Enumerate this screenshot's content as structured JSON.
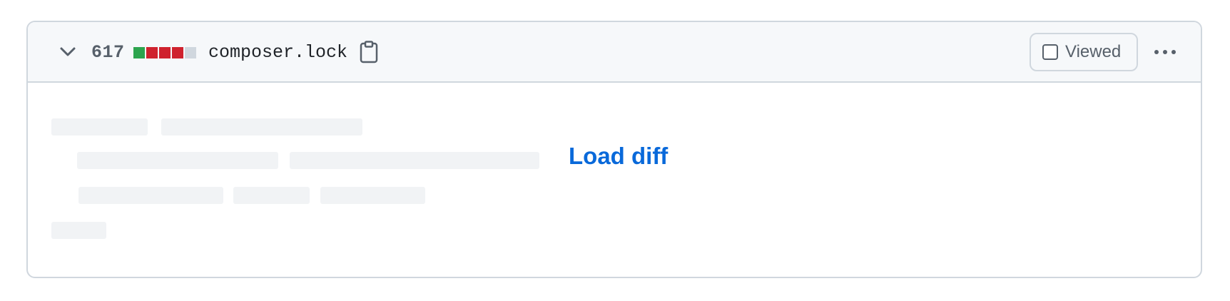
{
  "file": {
    "diff_count": "617",
    "file_name": "composer.lock",
    "diffstat_colors": [
      "#2da44e",
      "#cf222e",
      "#cf222e",
      "#cf222e",
      "#d0d7de"
    ],
    "viewed_label": "Viewed",
    "viewed_checked": false,
    "load_diff_label": "Load diff"
  },
  "icons": {
    "collapse": "chevron-down-icon",
    "copy": "clipboard-icon",
    "more": "kebab-horizontal-icon"
  }
}
